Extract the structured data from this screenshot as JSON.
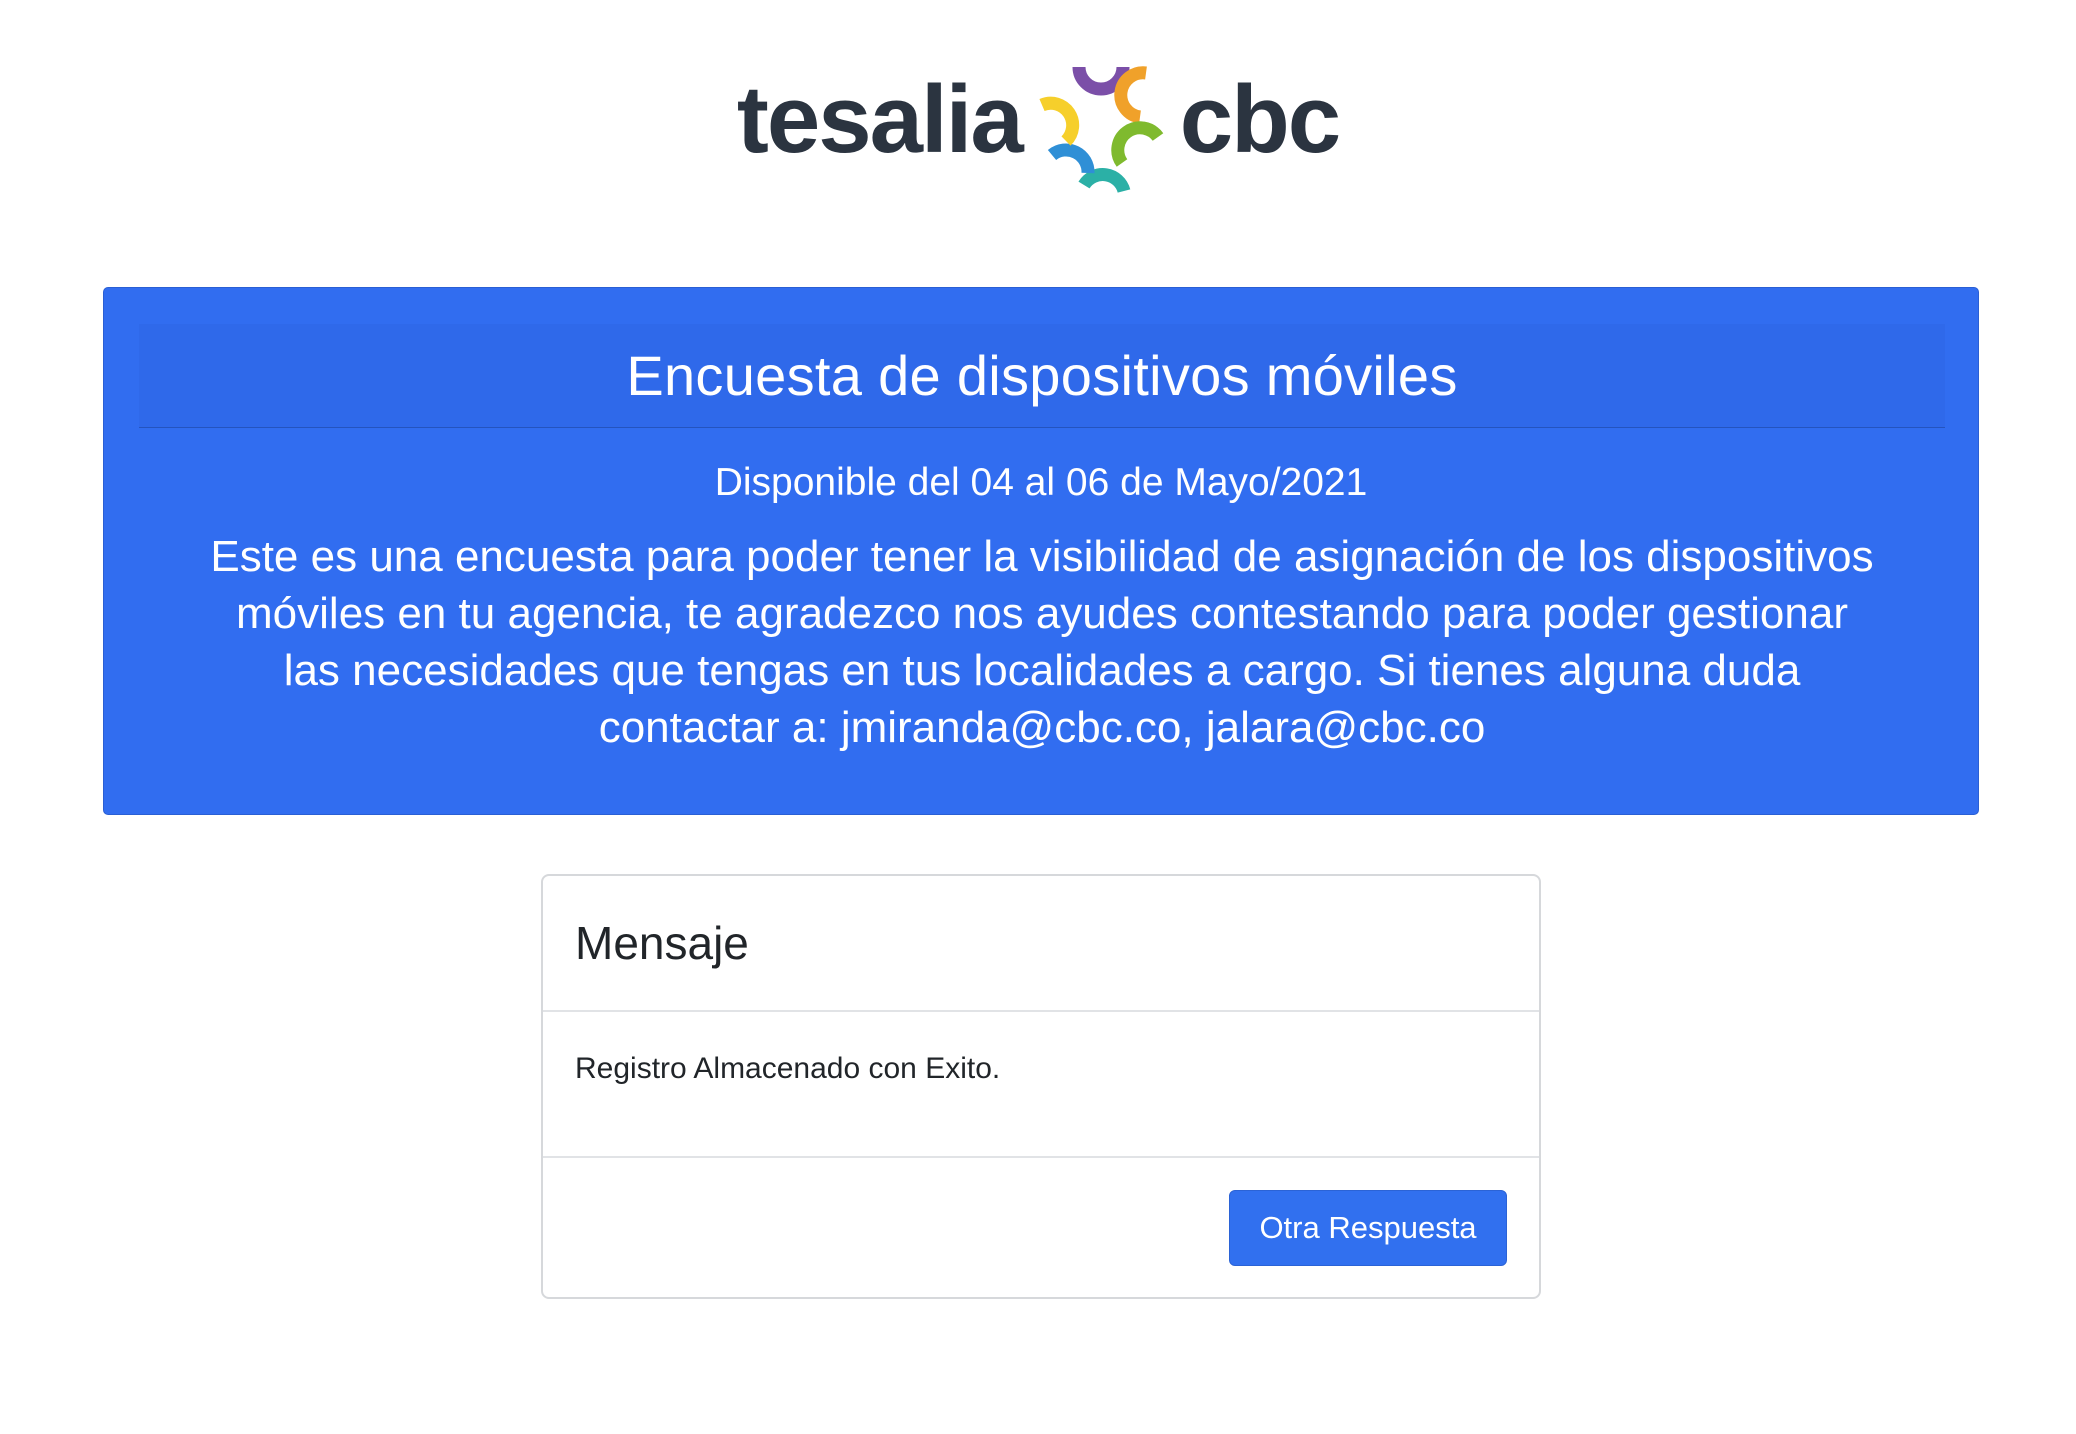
{
  "logo": {
    "left_word": "tesalia",
    "right_word": "cbc",
    "mark_colors": [
      "#7b4fa8",
      "#f0a12a",
      "#7fba2e",
      "#f6cf2b",
      "#2f8fd6",
      "#2bb0a6"
    ],
    "icon": "tesalia-cbc-logo-mark"
  },
  "banner": {
    "title": "Encuesta de dispositivos móviles",
    "dates": "Disponible del 04 al 06 de Mayo/2021",
    "description": "Este es una encuesta para poder tener la visibilidad de asignación de los dispositivos móviles en tu agencia, te agradezco nos ayudes contestando para poder gestionar las necesidades que tengas en tus localidades a cargo. Si tienes alguna duda contactar a: jmiranda@cbc.co, jalara@cbc.co",
    "color": "#316df0"
  },
  "message_card": {
    "title": "Mensaje",
    "body": "Registro Almacenado con Exito.",
    "button_label": "Otra Respuesta",
    "button_color": "#3170ef"
  }
}
